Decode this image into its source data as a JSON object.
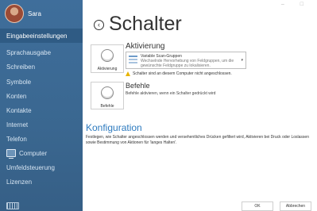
{
  "user": {
    "name": "Sara"
  },
  "sidebar": {
    "items": [
      {
        "label": "Eingabeeinstellungen",
        "active": true
      },
      {
        "label": "Sprachausgabe"
      },
      {
        "label": "Schreiben"
      },
      {
        "label": "Symbole"
      },
      {
        "label": "Konten"
      },
      {
        "label": "Kontakte"
      },
      {
        "label": "Internet"
      },
      {
        "label": "Telefon"
      },
      {
        "label": "Computer",
        "icon": "computer-icon"
      },
      {
        "label": "Umfeldsteuerung"
      },
      {
        "label": "Lizenzen"
      }
    ],
    "footer_icon": "keyboard-icon"
  },
  "page": {
    "title": "Schalter",
    "back_icon": "back-arrow-icon"
  },
  "aktivierung": {
    "title": "Aktivierung",
    "tile_label": "Aktivierung",
    "dropdown": {
      "selected": "Variable Scan-Gruppen",
      "description": "Wechselnde Hervorhebung von Feldgruppen, um die gewünschte Feldgruppe zu lokalisieren."
    },
    "warning": "Schalter sind an diesem Computer nicht angeschlossen."
  },
  "befehle": {
    "title": "Befehle",
    "tile_label": "Befehle",
    "description": "Befehle aktivieren, wenn ein Schalter gedrückt wird"
  },
  "konfiguration": {
    "title": "Konfiguration",
    "description": "Festlegen, wie Schalter angeschlossen werden und versehentliches Drücken gefiltert wird, Aktivieren bei Druck oder Loslassen sowie Bestimmung von Aktionen für 'langes Halten'."
  },
  "footer": {
    "ok_label": "OK",
    "cancel_label": "Abbrechen"
  },
  "colors": {
    "sidebar": "#3a6790",
    "sidebar_active": "#2f5b84",
    "accent": "#2e7bbf",
    "warning": "#e8b400"
  }
}
